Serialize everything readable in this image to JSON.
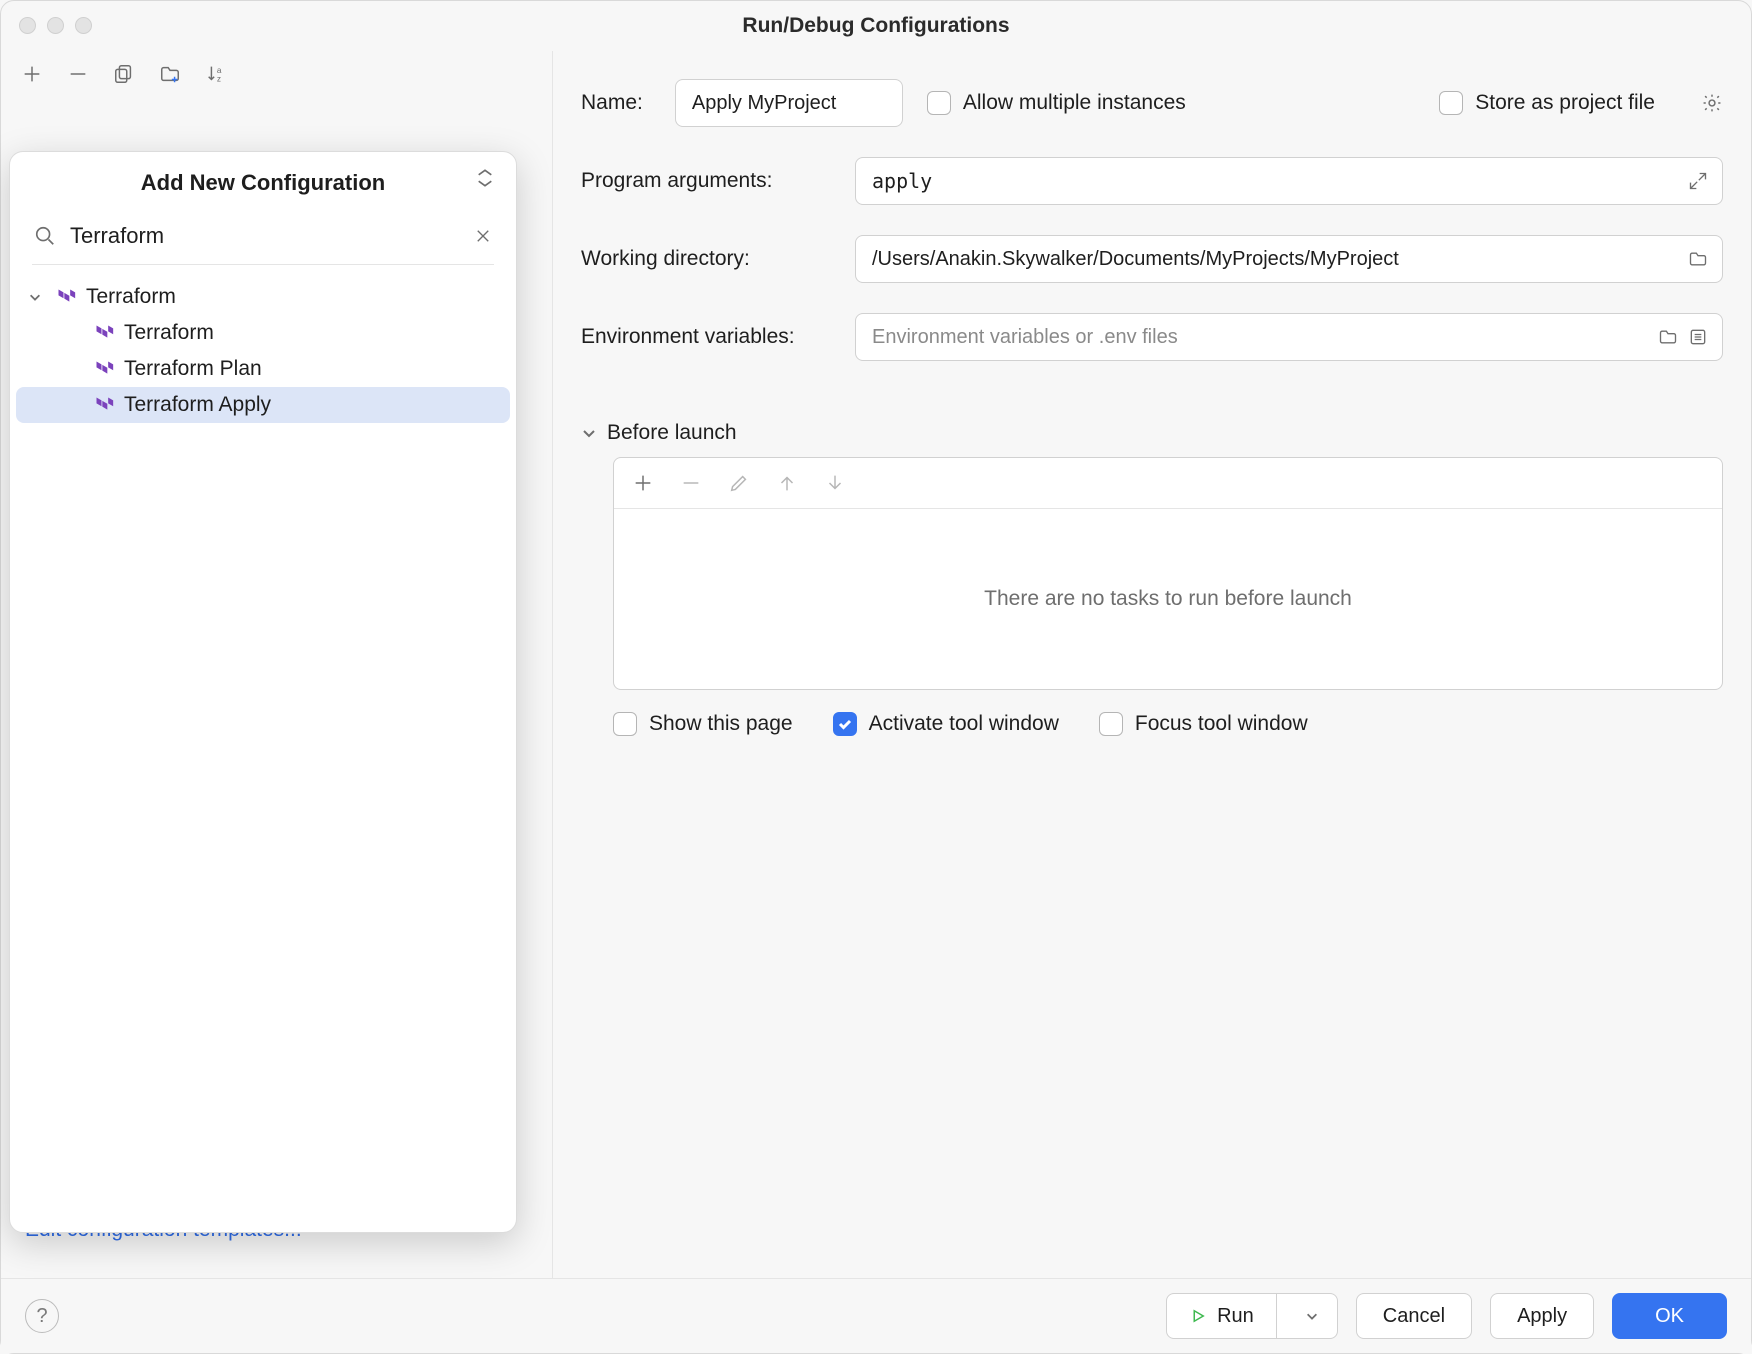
{
  "window": {
    "title": "Run/Debug Configurations"
  },
  "popover": {
    "title": "Add New Configuration",
    "search_value": "Terraform",
    "tree": {
      "group": "Terraform",
      "items": [
        "Terraform",
        "Terraform Plan",
        "Terraform Apply"
      ],
      "selected_index": 2
    }
  },
  "left": {
    "edit_templates": "Edit configuration templates..."
  },
  "form": {
    "name_label": "Name:",
    "name_value": "Apply MyProject",
    "allow_multiple": {
      "label": "Allow multiple instances",
      "checked": false
    },
    "store_project": {
      "label": "Store as project file",
      "checked": false
    },
    "args_label": "Program arguments:",
    "args_value": "apply",
    "workdir_label": "Working directory:",
    "workdir_value": "/Users/Anakin.Skywalker/Documents/MyProjects/MyProject",
    "env_label": "Environment variables:",
    "env_placeholder": "Environment variables or .env files",
    "env_value": ""
  },
  "before_launch": {
    "title": "Before launch",
    "empty_text": "There are no tasks to run before launch",
    "show_page": {
      "label": "Show this page",
      "checked": false
    },
    "activate_tool": {
      "label": "Activate tool window",
      "checked": true
    },
    "focus_tool": {
      "label": "Focus tool window",
      "checked": false
    }
  },
  "footer": {
    "run": "Run",
    "cancel": "Cancel",
    "apply": "Apply",
    "ok": "OK"
  }
}
